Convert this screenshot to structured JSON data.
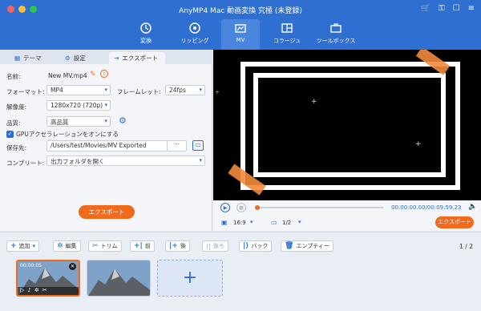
{
  "window": {
    "title": "AnyMP4 Mac 動画変換 究極 (未登録)"
  },
  "toolbar": {
    "items": [
      {
        "label": "変換",
        "icon": "convert-icon"
      },
      {
        "label": "リッピング",
        "icon": "ripper-icon"
      },
      {
        "label": "MV",
        "icon": "mv-icon"
      },
      {
        "label": "コラージュ",
        "icon": "collage-icon"
      },
      {
        "label": "ツールボックス",
        "icon": "toolbox-icon"
      }
    ],
    "active": "MV"
  },
  "left_tabs": [
    "テーマ",
    "設定",
    "エクスポート"
  ],
  "export": {
    "name_label": "名前:",
    "name_value": "New MV.mp4",
    "format_label": "フォーマット:",
    "format_value": "MP4",
    "framerate_label": "フレームレット:",
    "framerate_value": "24fps",
    "resolution_label": "解像度:",
    "resolution_value": "1280x720 (720p)",
    "quality_label": "品質:",
    "quality_value": "高品質",
    "gpu_label": "GPUアクセラレーションをオンにする",
    "gpu_checked": true,
    "save_label": "保存先:",
    "save_path": "/Users/test/Movies/MV Exported",
    "browse_label": "···",
    "complete_label": "コンプリート:",
    "complete_value": "出力フォルダを開く",
    "export_button": "エクスポート"
  },
  "player": {
    "time": "00:00:00.00/00:09:59.23",
    "aspect": "16:9",
    "page": "1/2",
    "export_button": "エクスポート",
    "progress": 0.0
  },
  "bottom": {
    "buttons": [
      "追加",
      "編集",
      "トリム",
      "前",
      "後",
      "後ろ",
      "バック",
      "エンプティー"
    ],
    "page_indicator": "1 / 2",
    "thumb_time": "00:00:05"
  },
  "colors": {
    "accent": "#2f6fd2",
    "orange": "#f26a1b"
  }
}
